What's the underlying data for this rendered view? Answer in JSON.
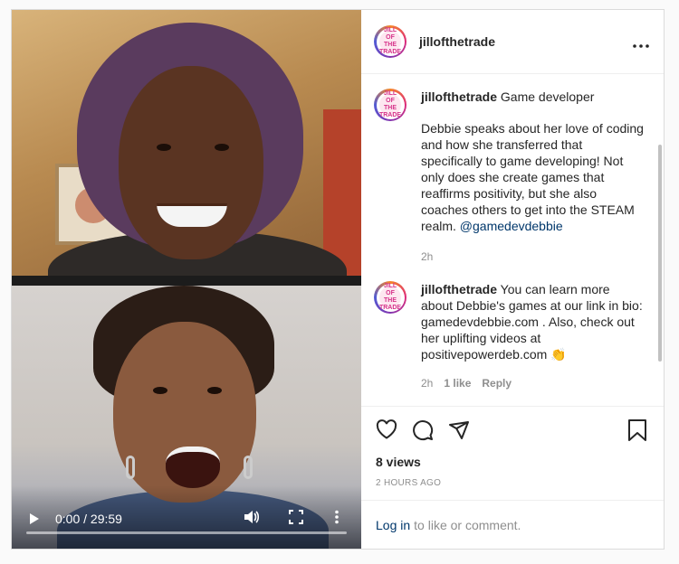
{
  "video": {
    "time": "0:00 / 29:59",
    "progress": 0.0
  },
  "post": {
    "username": "jillofthetrade",
    "avatar_text": "JILL OF THE TRADE",
    "more_icon": "more-horizontal-icon"
  },
  "comments": [
    {
      "username": "jillofthetrade",
      "title": "Game developer",
      "text": "Debbie speaks about her love of coding and how she transferred that specifically to game developing! Not only does she create games that reaffirms positivity, but she also coaches others to get into the STEAM realm.",
      "mention": "@gamedevdebbie",
      "time": "2h"
    },
    {
      "username": "jillofthetrade",
      "text": "You can learn more about Debbie's games at our link in bio: gamedevdebbie.com . Also, check out her uplifting videos at positivepowerdeb.com",
      "emoji": "👏",
      "time": "2h",
      "likes": "1 like",
      "reply": "Reply"
    }
  ],
  "actions": {
    "views": "8 views",
    "posted": "2 HOURS AGO"
  },
  "footer": {
    "login_link": "Log in",
    "login_text": "to like or comment."
  },
  "colors": {
    "link": "#00376b",
    "muted": "#8e8e8e",
    "border": "#dbdbdb"
  }
}
